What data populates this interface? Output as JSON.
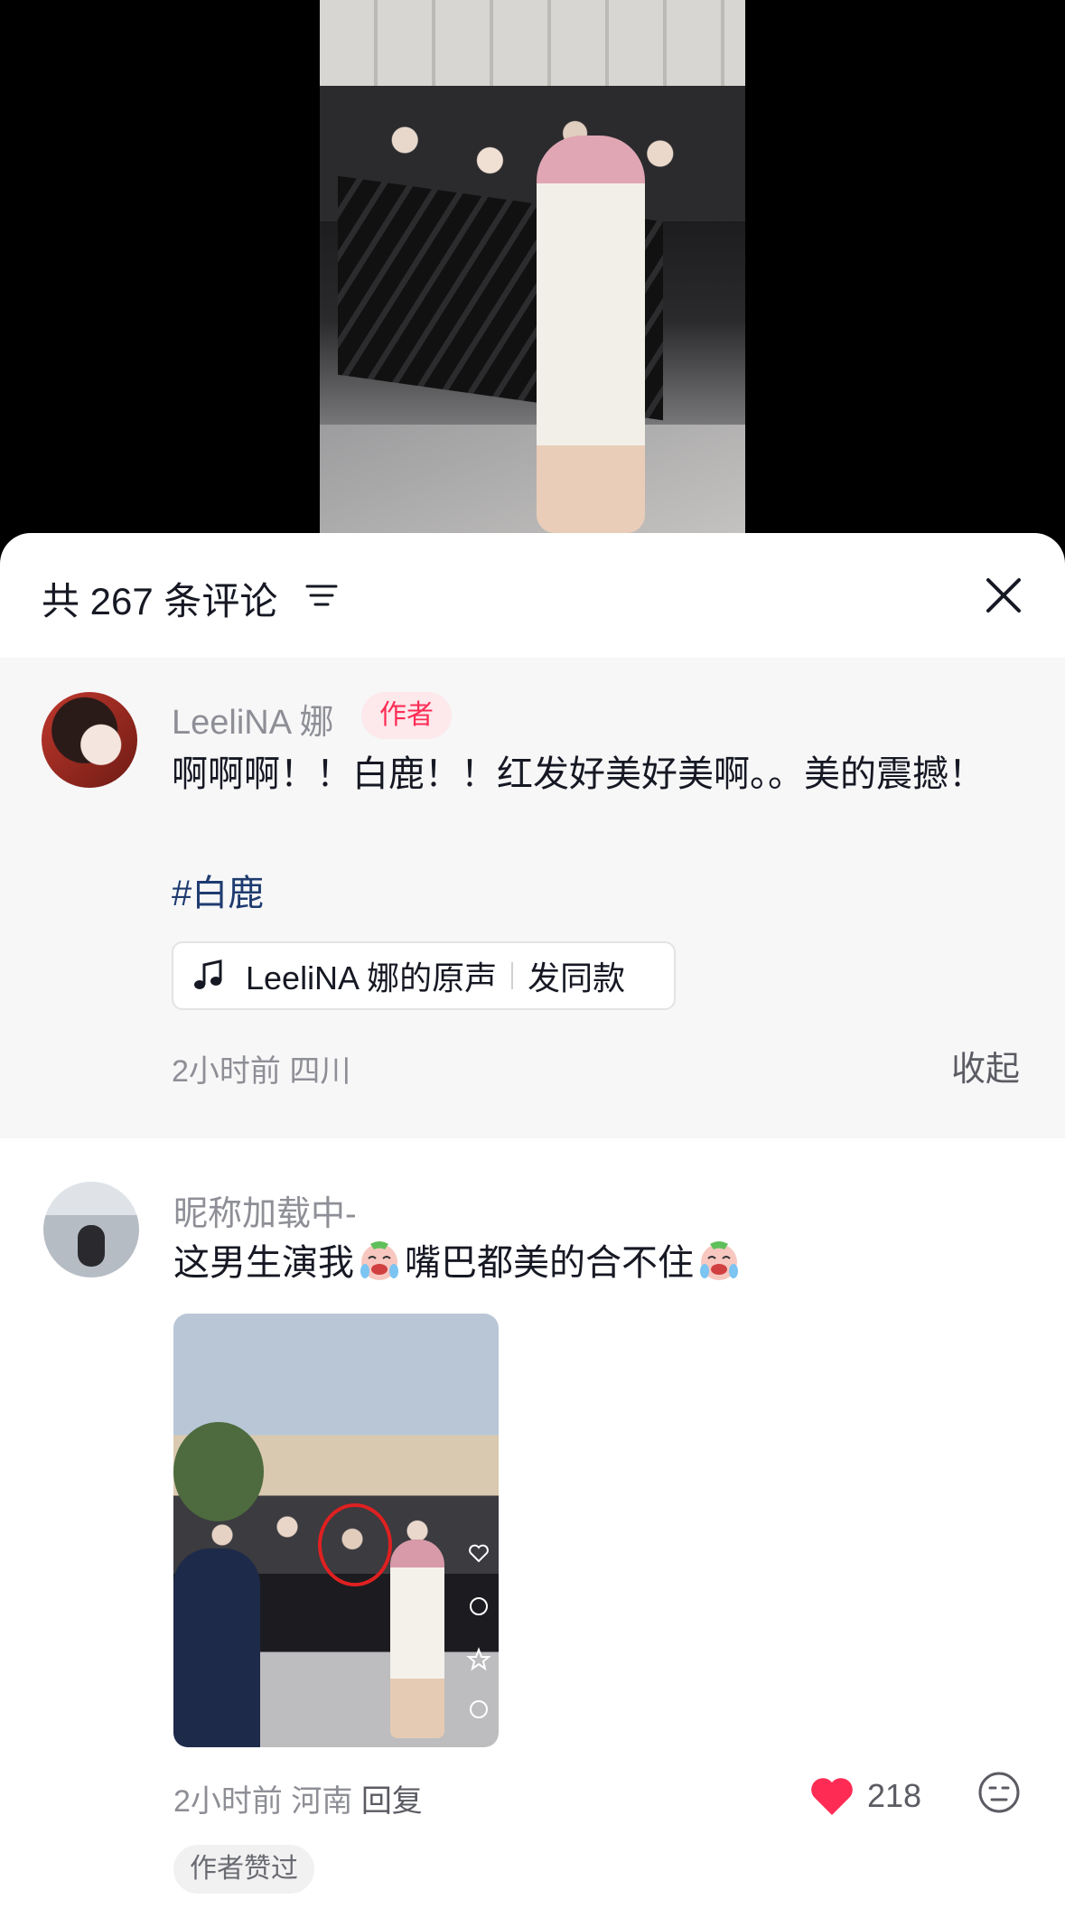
{
  "header": {
    "title": "共 267 条评论"
  },
  "author_comment": {
    "username": "LeeliNA 娜",
    "badge": "作者",
    "text": "啊啊啊！！白鹿！！红发好美好美啊。。美的震撼！",
    "hashtag": "#白鹿",
    "sound": {
      "name": "LeeliNA 娜的原声",
      "action": "发同款"
    },
    "meta": "2小时前  四川",
    "collapse_label": "收起"
  },
  "comment_2": {
    "username": "昵称加载中-",
    "text_part1": "这男生演我",
    "text_part2": "嘴巴都美的合不住",
    "emoji": "loudly-crying-emoji",
    "meta": "2小时前  河南  ",
    "reply_label": "回复",
    "likes": "218",
    "author_liked_tag": "作者赞过"
  },
  "colors": {
    "accent_red": "#fe2c55",
    "hashtag_blue": "#1f3c70",
    "heart_red": "#fe2c55"
  }
}
